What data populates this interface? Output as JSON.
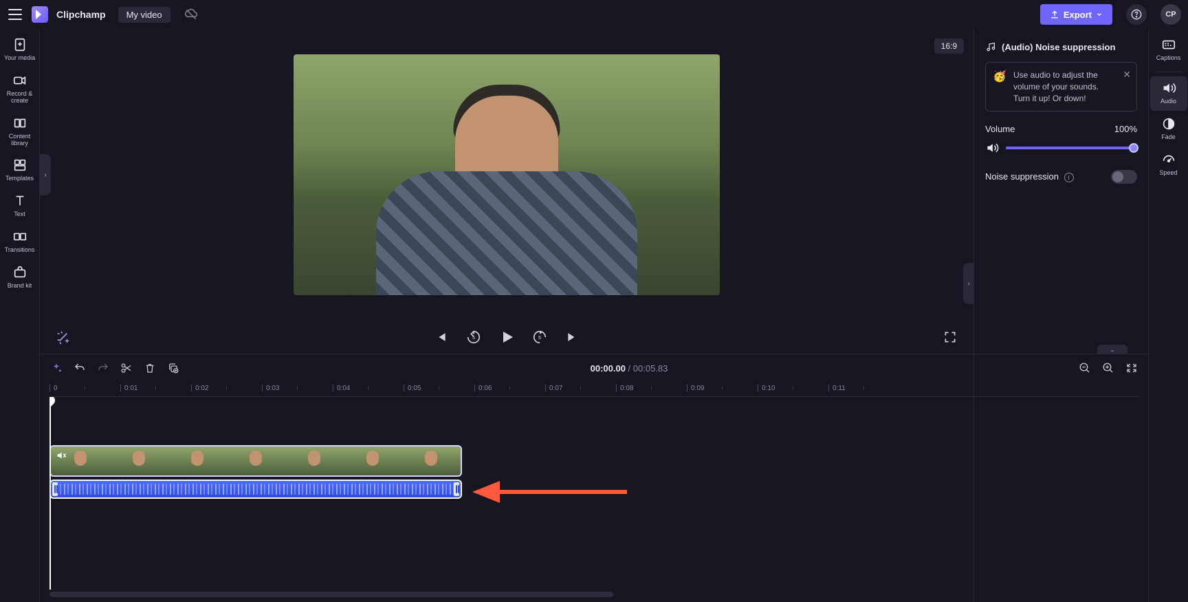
{
  "top": {
    "brand": "Clipchamp",
    "project": "My video",
    "export": "Export",
    "avatar": "CP"
  },
  "leftRail": {
    "items": [
      {
        "label": "Your media"
      },
      {
        "label": "Record &\ncreate"
      },
      {
        "label": "Content\nlibrary"
      },
      {
        "label": "Templates"
      },
      {
        "label": "Text"
      },
      {
        "label": "Transitions"
      },
      {
        "label": "Brand kit"
      }
    ]
  },
  "rightRail": {
    "items": [
      {
        "label": "Captions"
      },
      {
        "label": "Audio"
      },
      {
        "label": "Fade"
      },
      {
        "label": "Speed"
      }
    ]
  },
  "stage": {
    "aspect": "16:9"
  },
  "panel": {
    "title": "(Audio) Noise suppression",
    "tip": "Use audio to adjust the volume of your sounds. Turn it up! Or down!",
    "volumeLabel": "Volume",
    "volumeValue": "100%",
    "noiseLabel": "Noise suppression"
  },
  "timeline": {
    "timecode": "00:00.00",
    "sep": " / ",
    "duration": "00:05.83",
    "ticks": [
      "0",
      "0:01",
      "0:02",
      "0:03",
      "0:04",
      "0:05",
      "0:06",
      "0:07",
      "0:08",
      "0:09",
      "0:10",
      "0:11"
    ]
  }
}
